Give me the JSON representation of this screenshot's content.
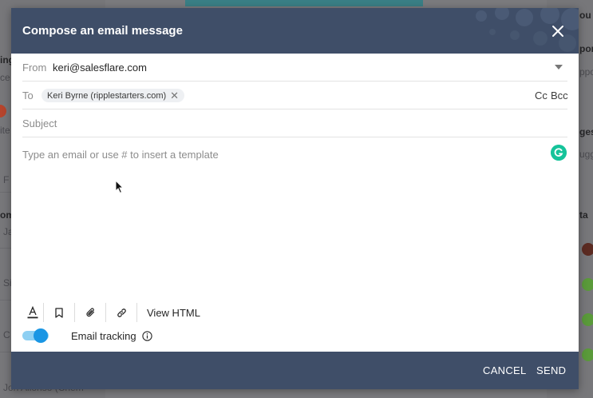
{
  "background": {
    "left_fragments": [
      "ing",
      "ce",
      "ite",
      "F",
      "om",
      "Ja",
      "Si",
      "C",
      "Jon Allonso (Chem"
    ],
    "right_fragments": [
      "ou",
      "por",
      "ppo",
      "ges",
      "ugg",
      "ta"
    ]
  },
  "modal": {
    "title": "Compose an email message",
    "from": {
      "label": "From",
      "value": "keri@salesflare.com"
    },
    "to": {
      "label": "To",
      "recipients": [
        {
          "name": "Keri Byrne (ripplestarters.com)"
        }
      ],
      "cc_label": "Cc",
      "bcc_label": "Bcc"
    },
    "subject": {
      "placeholder": "Subject",
      "value": ""
    },
    "body": {
      "placeholder": "Type an email or use # to insert a template",
      "value": ""
    },
    "toolbar": {
      "view_html_label": "View HTML"
    },
    "tracking": {
      "label": "Email tracking",
      "enabled": true
    },
    "footer": {
      "cancel_label": "CANCEL",
      "send_label": "SEND"
    }
  },
  "colors": {
    "header": "#3f4e68",
    "toggle_on": "#1a96e4",
    "grammarly": "#15c39a"
  }
}
